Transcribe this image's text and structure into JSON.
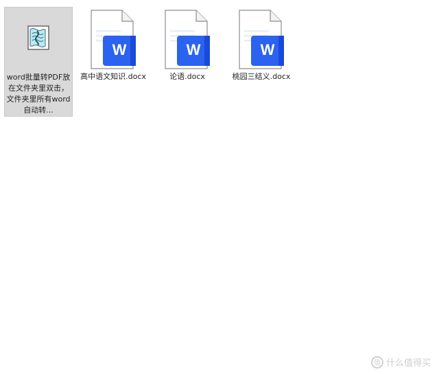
{
  "files": [
    {
      "name": "word批量转PDF放在文件夹里双击，文件夹里所有word自动转...",
      "icon": "vbscript-file-icon",
      "selected": true
    },
    {
      "name": "高中语文知识.docx",
      "icon": "word-document-icon",
      "selected": false
    },
    {
      "name": "论语.docx",
      "icon": "word-document-icon",
      "selected": false
    },
    {
      "name": "桃园三结义.docx",
      "icon": "word-document-icon",
      "selected": false
    }
  ],
  "watermark": {
    "logo": "值",
    "text": "什么值得买"
  },
  "colors": {
    "word_blue": "#2b63f0",
    "word_blue_dark": "#1a4ad9",
    "selection_bg": "#d9d9d9"
  }
}
